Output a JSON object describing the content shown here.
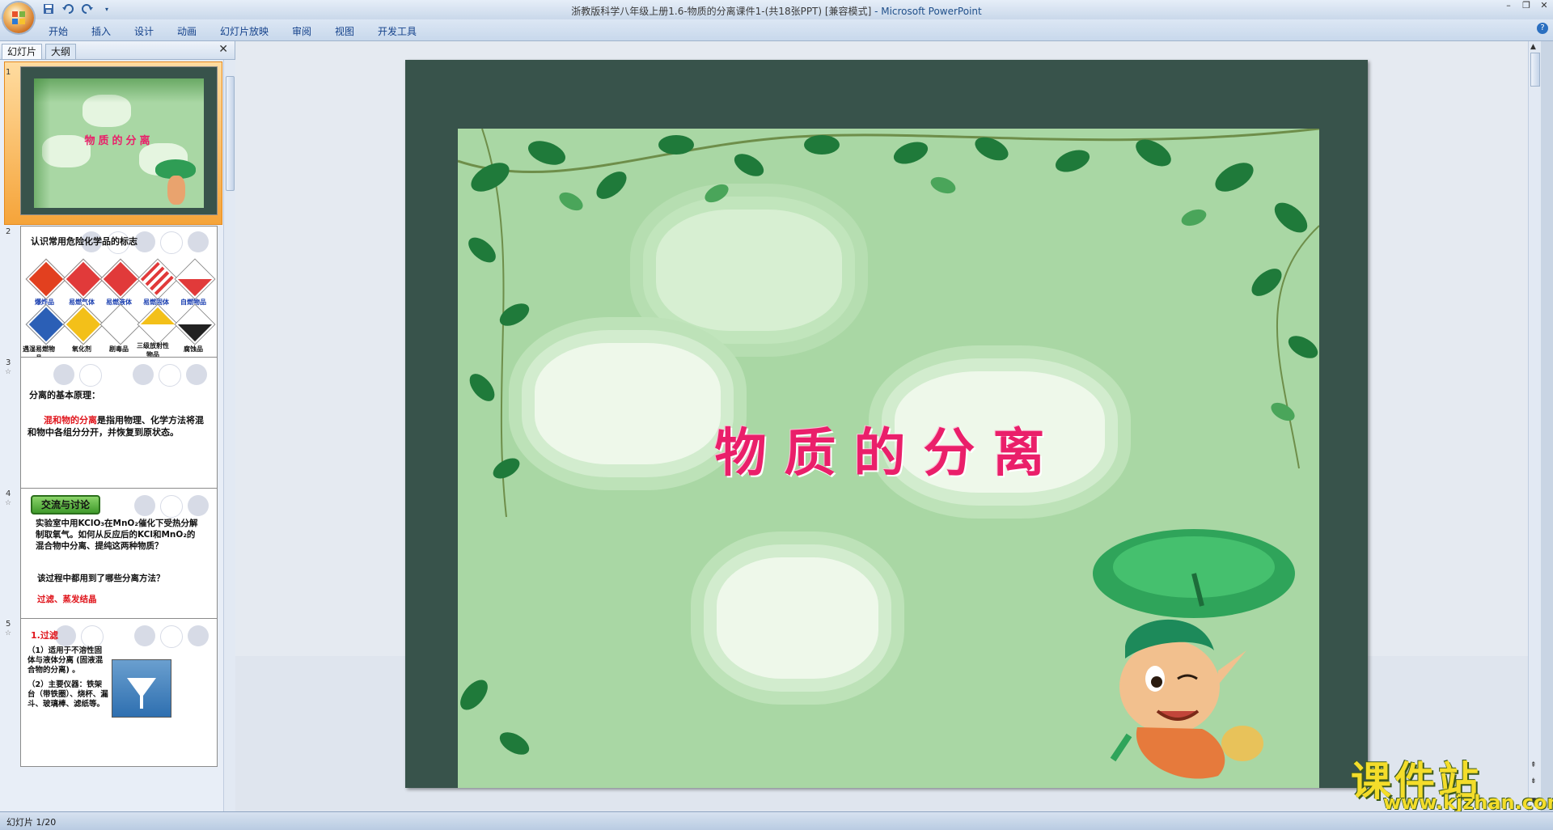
{
  "window": {
    "title": "浙教版科学八年级上册1.6-物质的分离课件1-(共18张PPT) [兼容模式]",
    "app_name": "- Microsoft PowerPoint",
    "help": "?"
  },
  "quick_access": [
    "save-icon",
    "undo-icon",
    "redo-icon",
    "customize-icon"
  ],
  "ribbon_tabs": [
    "开始",
    "插入",
    "设计",
    "动画",
    "幻灯片放映",
    "审阅",
    "视图",
    "开发工具"
  ],
  "left_pane": {
    "tabs": [
      "幻灯片",
      "大纲"
    ],
    "close": "✕",
    "slides": [
      {
        "num": "1",
        "title": "物质的分离"
      },
      {
        "num": "2",
        "title": "认识常用危险化学品的标志",
        "row1": [
          "爆炸品",
          "易燃气体",
          "易燃液体",
          "易燃固体",
          "自燃物品"
        ],
        "row2": [
          "遇湿易燃物品",
          "氧化剂",
          "剧毒品",
          "三级放射性物品",
          "腐蚀品"
        ]
      },
      {
        "num": "3",
        "heading": "分离的基本原理：",
        "highlight": "混和物的分离",
        "body": "是指用物理、化学方法将混和物中各组分分开，并恢复到原状态。"
      },
      {
        "num": "4",
        "badge": "交流与讨论",
        "body": "实验室中用KClO₃在MnO₂催化下受热分解制取氧气。如何从反应后的KCl和MnO₂的混合物中分离、提纯这两种物质？",
        "question": "该过程中都用到了哪些分离方法？",
        "answer": "过滤、蒸发结晶"
      },
      {
        "num": "5",
        "heading": "1.过滤",
        "p1": "（1）适用于不溶性固体与液体分离 (固液混合物的分离) 。",
        "p2": "（2）主要仪器：铁架台（带铁圈）、烧杯、漏斗、玻璃棒、滤纸等。"
      }
    ]
  },
  "slide": {
    "title": "物质的分离"
  },
  "watermark": {
    "text": "课件站",
    "url": "www.kjzhan.com"
  },
  "status": {
    "text": "幻灯片 1/20"
  },
  "colors": {
    "title_pink": "#ea1f6a",
    "frame": "#38534b",
    "slide_bg": "#a9d7a4"
  }
}
